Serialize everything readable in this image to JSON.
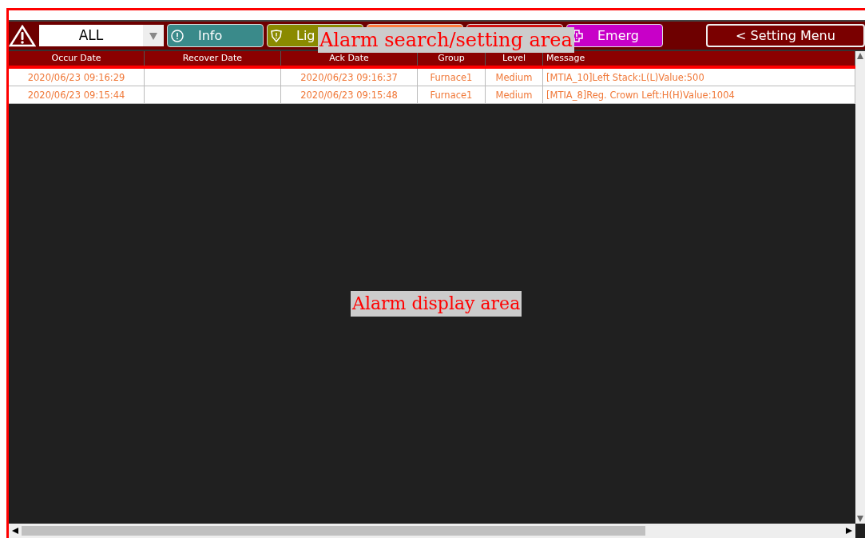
{
  "toolbar": {
    "filter": {
      "value": "ALL"
    },
    "level_buttons": [
      {
        "label": "Info",
        "color": "#3a8a8a",
        "kind": "info"
      },
      {
        "label": "Lig",
        "color": "#8a8a00",
        "kind": "light"
      },
      {
        "color": "#ff7a3a",
        "kind": "covered"
      },
      {
        "color": "#d01010",
        "kind": "covered"
      },
      {
        "label": "Emerg",
        "color": "#c800c8",
        "kind": "emergency"
      }
    ],
    "setting_button": "< Setting Menu"
  },
  "table": {
    "columns": [
      "Occur Date",
      "Recover Date",
      "Ack Date",
      "Group",
      "Level",
      "Message"
    ],
    "rows": [
      [
        "2020/06/23 09:16:29",
        "",
        "2020/06/23 09:16:37",
        "Furnace1",
        "Medium",
        "[MTIA_10]Left Stack:L(L)Value:500"
      ],
      [
        "2020/06/23 09:15:44",
        "",
        "2020/06/23 09:15:48",
        "Furnace1",
        "Medium",
        "[MTIA_8]Reg. Crown Left:H(H)Value:1004"
      ]
    ]
  },
  "annotations": [
    "Alarm search/setting area",
    "Alarm display area"
  ]
}
